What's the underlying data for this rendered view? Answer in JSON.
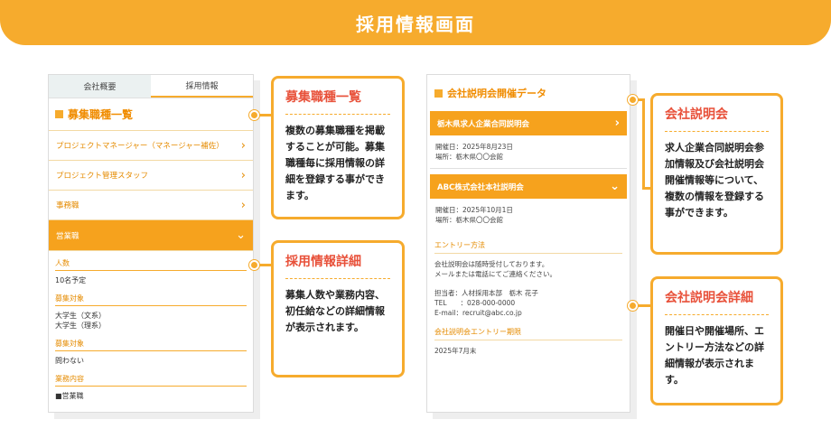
{
  "banner": {
    "title": "採用情報画面"
  },
  "left_panel": {
    "tabs": [
      {
        "label": "会社概要",
        "active": false
      },
      {
        "label": "採用情報",
        "active": true
      }
    ],
    "section_title": "募集職種一覧",
    "jobs": [
      {
        "label": "プロジェクトマネージャー（マネージャー補佐）"
      },
      {
        "label": "プロジェクト管理スタッフ"
      },
      {
        "label": "事務職"
      },
      {
        "label": "営業職"
      }
    ],
    "details": [
      {
        "label": "人数",
        "value": "10名予定"
      },
      {
        "label": "募集対象",
        "value": "大学生（文系）\n大学生（理系）"
      },
      {
        "label": "募集対象",
        "value": "問わない"
      },
      {
        "label": "業務内容",
        "value": "■営業職"
      }
    ]
  },
  "right_panel": {
    "title": "会社説明会開催データ",
    "events": [
      {
        "name": "栃木県求人企業合同説明会",
        "date": "開催日：2025年8月23日",
        "place": "場所：栃木県〇〇会館"
      },
      {
        "name": "ABC株式会社本社説明会",
        "date": "開催日：2025年10月1日",
        "place": "場所：栃木県〇〇会館"
      }
    ],
    "entry_label": "エントリー方法",
    "entry_line1": "会社説明会は随時受付しております。",
    "entry_line2": "メールまたは電話にてご連絡ください。",
    "contact_person": "担当者：人材採用本部　栃木 花子",
    "contact_tel": "TEL　　：028-000-0000",
    "contact_email": "E-mail：recruit@abc.co.jp",
    "deadline_label": "会社説明会エントリー期限",
    "deadline_value": "2025年7月末"
  },
  "callouts": {
    "job_list": {
      "title": "募集職種一覧",
      "body": "複数の募集職種を掲載することが可能。募集職種毎に採用情報の詳細を登録する事ができます。"
    },
    "job_detail": {
      "title": "採用情報詳細",
      "body": "募集人数や業務内容、初任給などの詳細情報が表示されます。"
    },
    "seminar": {
      "title": "会社説明会",
      "body": "求人企業合同説明会参加情報及び会社説明会開催情報等について、複数の情報を登録する事ができます。"
    },
    "seminar_detail": {
      "title": "会社説明会詳細",
      "body": "開催日や開催場所、エントリー方法などの詳細情報が表示されます。"
    }
  },
  "colors": {
    "accent": "#f6ab2d",
    "heading": "#e8513a",
    "tab_bg": "#ebf1f1"
  },
  "icons": {
    "row_arrow": "chevron-right-icon",
    "expand_arrow": "chevron-down-icon",
    "bullet": "square-bullet-icon"
  }
}
